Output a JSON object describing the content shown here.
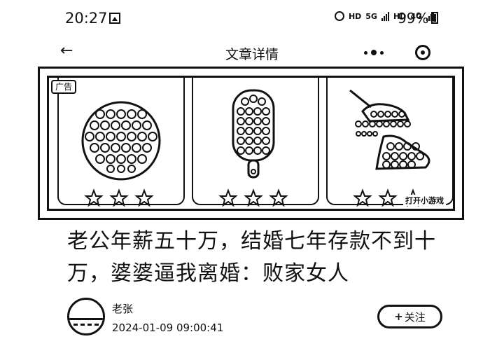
{
  "status_bar": {
    "time": "20:27",
    "network_labels": [
      "HD",
      "5G",
      "HD",
      "4G"
    ],
    "battery": "99%"
  },
  "nav": {
    "title": "文章详情"
  },
  "ad": {
    "tag": "广告",
    "cta": "打开小游戏",
    "items": [
      {
        "icon": "round-pop-it-icon",
        "stars": [
          "☆",
          "☆",
          "☆"
        ]
      },
      {
        "icon": "popsicle-pop-it-icon",
        "stars": [
          "☆",
          "☆",
          "☆"
        ]
      },
      {
        "icon": "unicorn-pop-it-icon",
        "stars": [
          "☆",
          "☆",
          "☆"
        ]
      }
    ]
  },
  "article": {
    "title": "老公年薪五十万，结婚七年存款不到十万，婆婆逼我离婚：败家女人",
    "author": "老张",
    "date": "2024-01-09 09:00:41",
    "follow_plus": "+",
    "follow_label": "关注"
  }
}
